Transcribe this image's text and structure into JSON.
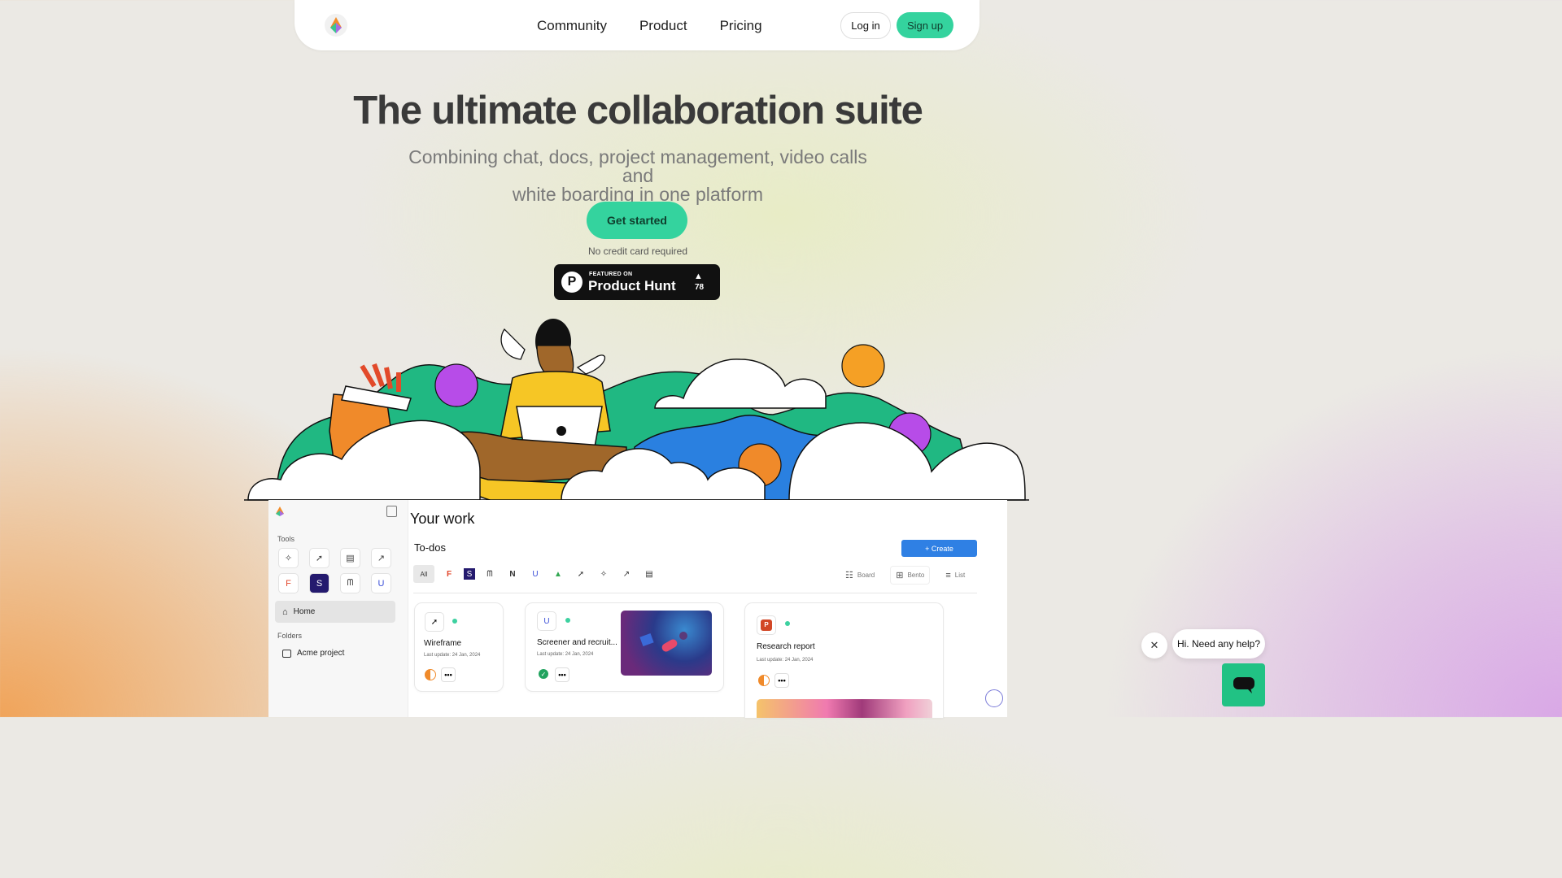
{
  "nav": {
    "links": [
      "Community",
      "Product",
      "Pricing"
    ],
    "login": "Log in",
    "signup": "Sign up"
  },
  "hero": {
    "title": "The ultimate collaboration suite",
    "subtitle_line1": "Combining chat, docs, project management, video calls and",
    "subtitle_line2": "white boarding in one platform",
    "cta": "Get started",
    "note": "No credit card required"
  },
  "product_hunt": {
    "featured": "FEATURED ON",
    "name": "Product Hunt",
    "votes": "78"
  },
  "app": {
    "tools_label": "Tools",
    "home": "Home",
    "folders_label": "Folders",
    "folder": "Acme project",
    "title": "Your work",
    "todos": "To-dos",
    "create": "+ Create",
    "filter_all": "All",
    "views": [
      "Board",
      "Bento",
      "List"
    ],
    "cards": [
      {
        "title": "Wireframe",
        "date": "Last update: 24 Jan, 2024"
      },
      {
        "title": "Screener and recruit...",
        "date": "Last update: 24 Jan, 2024"
      },
      {
        "title": "Research report",
        "date": "Last update: 24 Jan, 2024"
      }
    ]
  },
  "chat": {
    "message": "Hi. Need any help?"
  },
  "colors": {
    "accent": "#34d39e",
    "create_blue": "#2f80e4",
    "chat_green": "#21c284"
  }
}
